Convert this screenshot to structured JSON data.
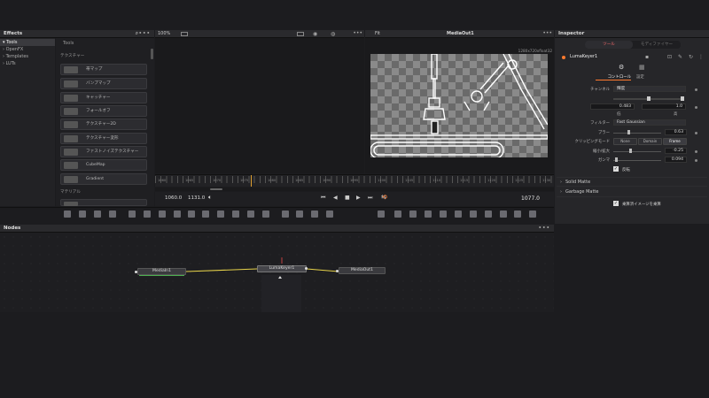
{
  "effects": {
    "title": "Effects",
    "tree": [
      "Tools",
      "OpenFX",
      "Templates",
      "LUTs"
    ],
    "tools_header": "Tools",
    "category_texture": "テクスチャー",
    "tools": [
      "帯マップ",
      "バンプマップ",
      "キャッチャー",
      "フォールオフ",
      "テクスチャー2D",
      "テクスチャー変形",
      "ファストノイズテクスチャー",
      "CubeMap",
      "Gradient"
    ],
    "category_material": "マテリアル"
  },
  "viewer_left": {
    "zoom": "100%"
  },
  "viewer_right": {
    "zoom": "Fit",
    "title": "MediaOut1",
    "resolution": "1280x720xfloat32"
  },
  "timeline": {
    "ticks": [
      "1060",
      "1065",
      "1070",
      "1075",
      "1080",
      "1085",
      "1090",
      "1095",
      "1100",
      "1105",
      "1110",
      "1115",
      "1120",
      "1125",
      "1130"
    ],
    "start": "1060.0",
    "end": "1131.0",
    "current": "1077.0"
  },
  "nodes": {
    "title": "Nodes",
    "items": [
      "MediaIn1",
      "LumaKeyer1",
      "MediaOut1"
    ]
  },
  "inspector": {
    "title": "Inspector",
    "tabs": [
      "ツール",
      "モディファイヤー"
    ],
    "node_name": "LumaKeyer1",
    "subtabs": [
      "コントロール",
      "設定"
    ],
    "channel_label": "チャンネル",
    "channel_value": "輝度",
    "low_value": "0.483",
    "high_value": "1.0",
    "low_label": "低",
    "high_label": "高",
    "filter_label": "フィルター",
    "filter_value": "Fast Gaussian",
    "blur_label": "ブラー",
    "blur_value": "0.63",
    "clip_label": "クリッピングモード",
    "clip_options": [
      "None",
      "Domain",
      "Frame"
    ],
    "shrink_label": "縮小/拡大",
    "shrink_value": "-0.25",
    "gamma_label": "ガンマ",
    "gamma_value": "0.094",
    "invert_label": "反転",
    "solid_matte": "Solid Matte",
    "garbage_matte": "Garbage Matte",
    "post_multiply": "乗算済イメージを乗算"
  }
}
